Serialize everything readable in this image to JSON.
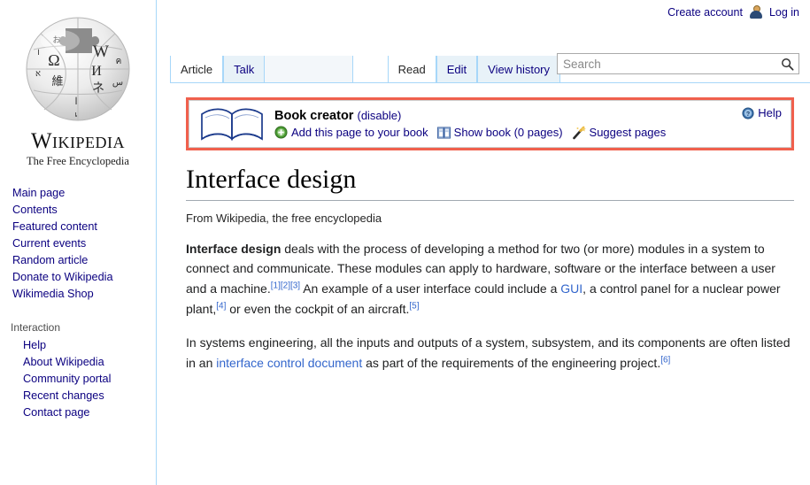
{
  "personal_bar": {
    "create_account": "Create account",
    "login": "Log in",
    "user_icon": "user-avatar-icon"
  },
  "sidebar": {
    "logo": {
      "icon": "wikipedia-globe-logo",
      "wordmark": "Wikipedia",
      "tagline": "The Free Encyclopedia"
    },
    "navigation": {
      "items": [
        {
          "label": "Main page"
        },
        {
          "label": "Contents"
        },
        {
          "label": "Featured content"
        },
        {
          "label": "Current events"
        },
        {
          "label": "Random article"
        },
        {
          "label": "Donate to Wikipedia"
        },
        {
          "label": "Wikimedia Shop"
        }
      ]
    },
    "interaction": {
      "heading": "Interaction",
      "items": [
        {
          "label": "Help"
        },
        {
          "label": "About Wikipedia"
        },
        {
          "label": "Community portal"
        },
        {
          "label": "Recent changes"
        },
        {
          "label": "Contact page"
        }
      ]
    }
  },
  "tabs": {
    "namespaces": [
      {
        "label": "Article",
        "selected": true
      },
      {
        "label": "Talk",
        "selected": false
      }
    ],
    "views": [
      {
        "label": "Read",
        "selected": true
      },
      {
        "label": "Edit",
        "selected": false
      },
      {
        "label": "View history",
        "selected": false
      }
    ]
  },
  "search": {
    "placeholder": "Search",
    "value": "",
    "icon": "search-magnifier-icon"
  },
  "book_creator": {
    "icon": "open-book-icon",
    "title": "Book creator",
    "disable_label": "(disable)",
    "actions": [
      {
        "label": "Add this page to your book",
        "icon": "green-plus-circle-icon"
      },
      {
        "label": "Show book (0 pages)",
        "icon": "blue-book-icon"
      },
      {
        "label": "Suggest pages",
        "icon": "magic-wand-icon"
      }
    ],
    "help_label": "Help",
    "help_icon": "blue-question-circle-icon",
    "border_color": "#f0604d"
  },
  "article": {
    "title": "Interface design",
    "subtitle": "From Wikipedia, the free encyclopedia",
    "paragraph1": {
      "bold_lead": "Interface design",
      "text_a": " deals with the process of developing a method for two (or more) modules in a system to connect and communicate. These modules can apply to hardware, software or the interface between a user and a machine.",
      "refs_a": "[1][2][3]",
      "text_b": " An example of a user interface could include a ",
      "link_gui": "GUI",
      "text_c": ", a control panel for a nuclear power plant,",
      "ref_b": "[4]",
      "text_d": " or even the cockpit of an aircraft.",
      "ref_c": "[5]"
    },
    "paragraph2": {
      "text_a": "In systems engineering, all the inputs and outputs of a system, subsystem, and its components are often listed in an ",
      "link_icd": "interface control document",
      "text_b": " as part of the requirements of the engineering project.",
      "ref_a": "[6]"
    }
  }
}
